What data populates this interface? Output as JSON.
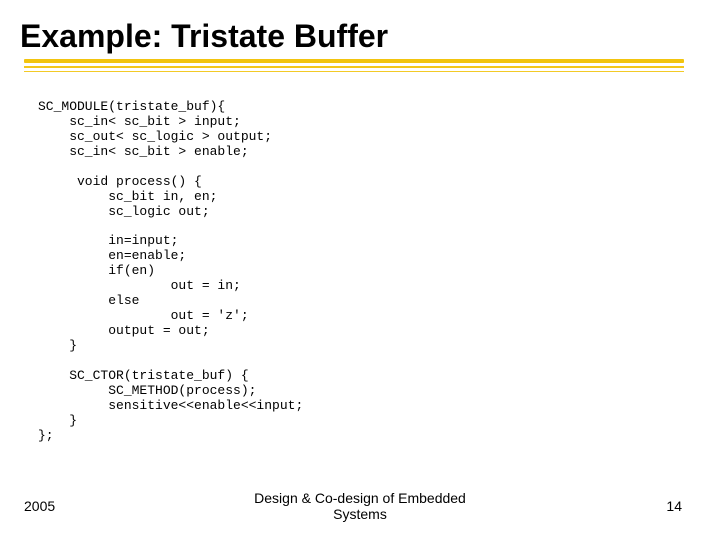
{
  "title": "Example: Tristate Buffer",
  "code": "SC_MODULE(tristate_buf){\n    sc_in< sc_bit > input;\n    sc_out< sc_logic > output;\n    sc_in< sc_bit > enable;\n\n     void process() {\n         sc_bit in, en;\n         sc_logic out;\n\n         in=input;\n         en=enable;\n         if(en)\n                 out = in;\n         else\n                 out = 'z';\n         output = out;\n    }\n\n    SC_CTOR(tristate_buf) {\n         SC_METHOD(process);\n         sensitive<<enable<<input;\n    }\n};",
  "footer": {
    "left": "2005",
    "center_line1": "Design & Co-design of Embedded",
    "center_line2": "Systems",
    "right": "14"
  }
}
